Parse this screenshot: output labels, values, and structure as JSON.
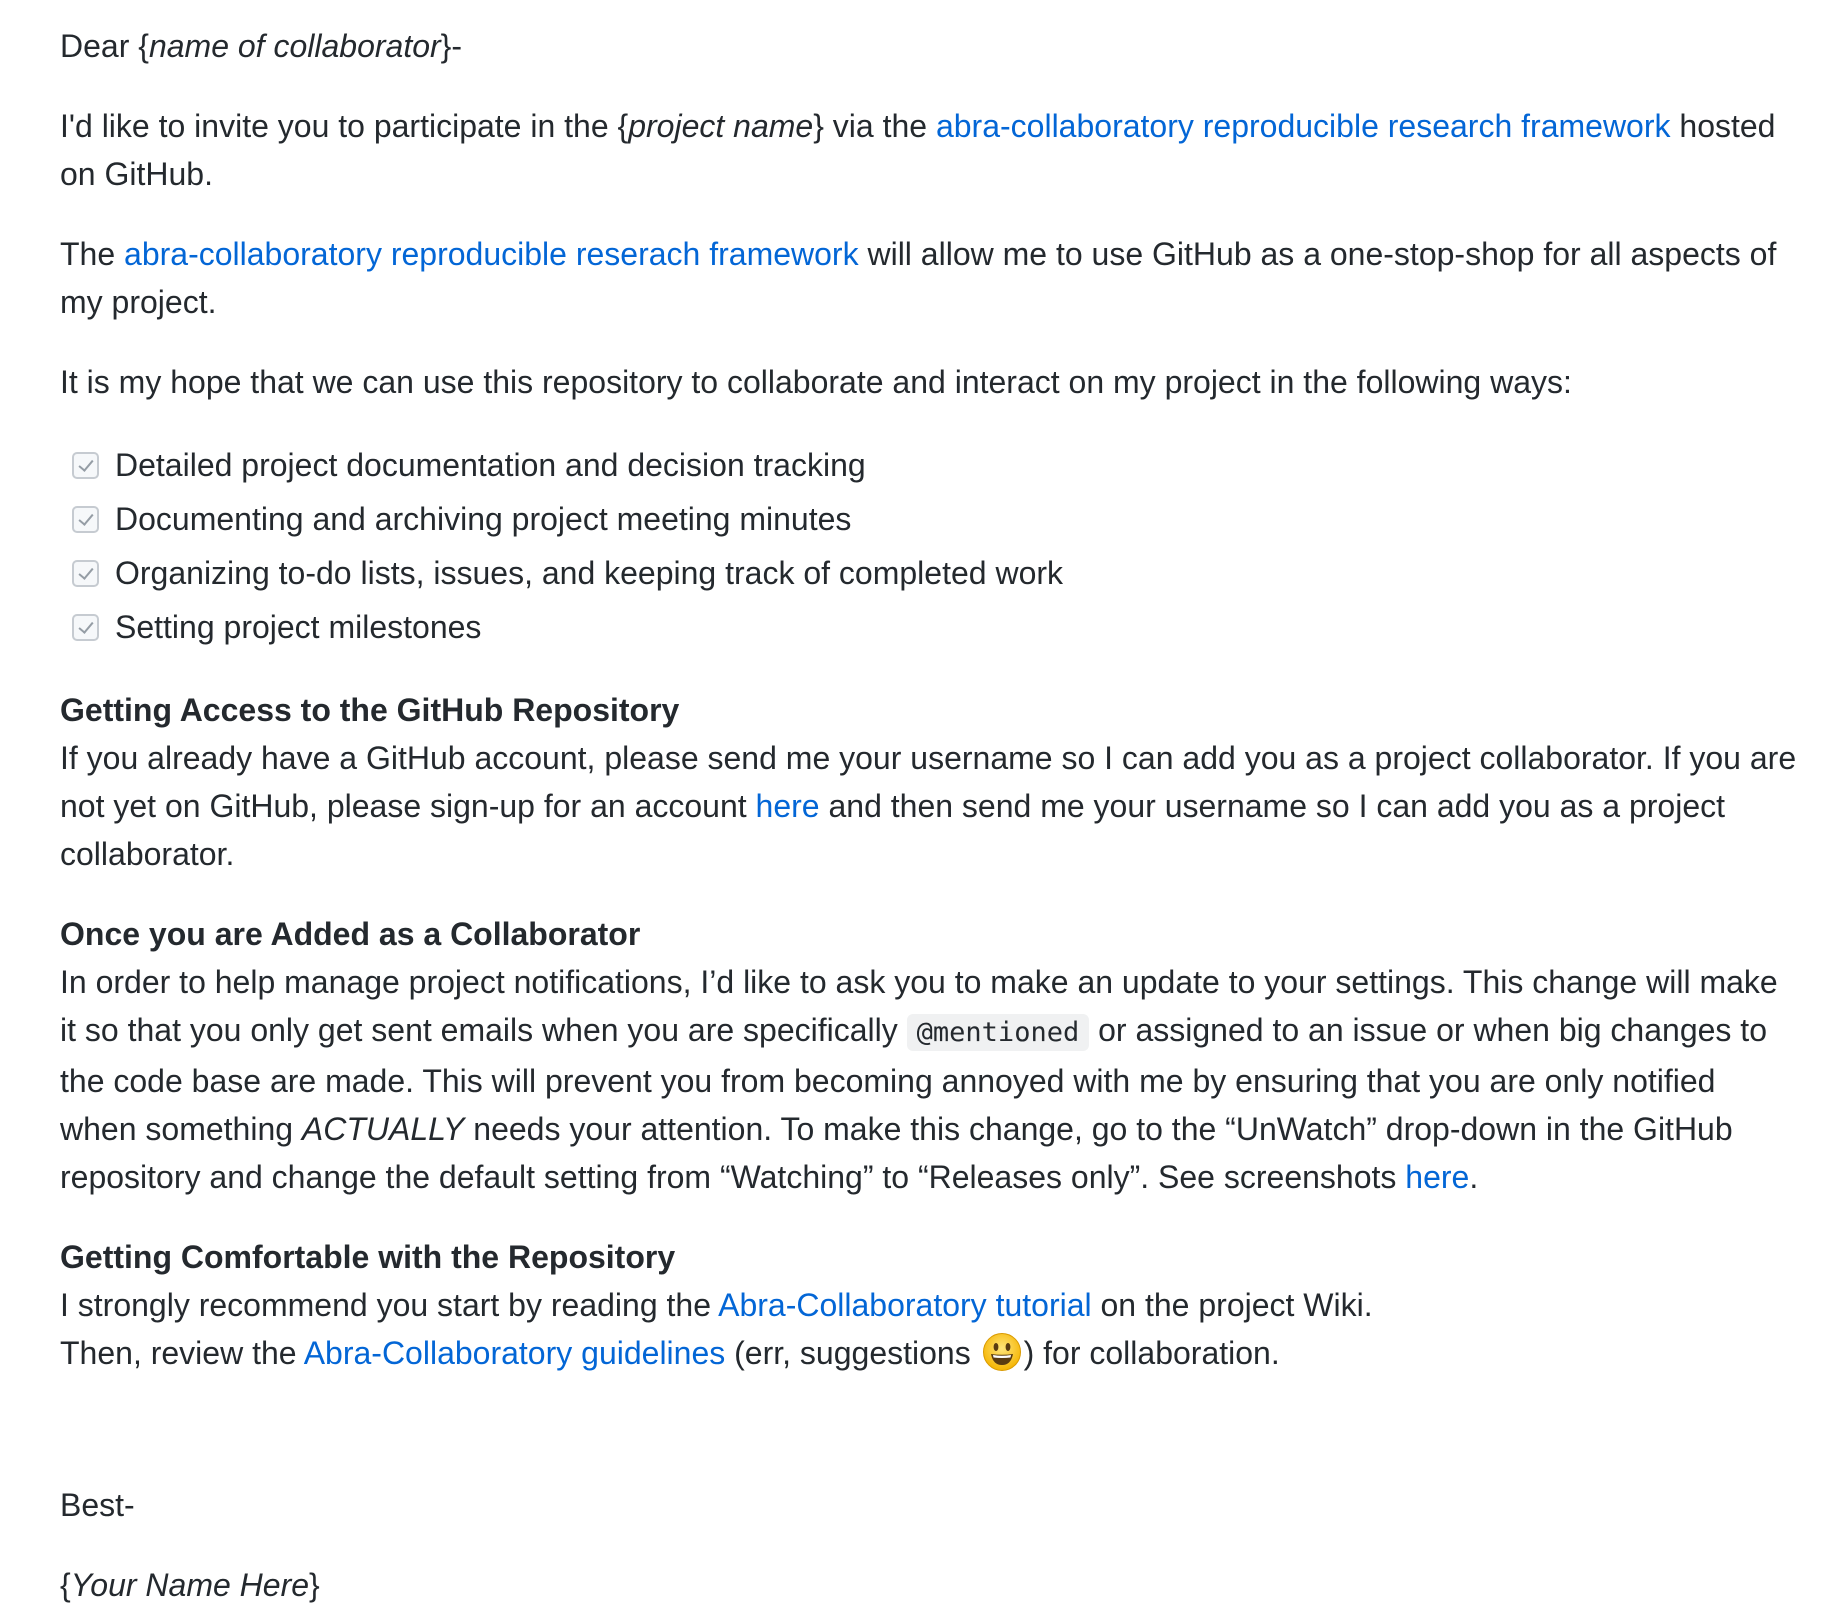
{
  "greeting": {
    "prefix": "Dear {",
    "name_placeholder": "name of collaborator",
    "suffix": "}-"
  },
  "intro": {
    "text1": "I'd like to invite you to participate in the {",
    "project_placeholder": "project name",
    "text2": "} via the ",
    "link": "abra-collaboratory reproducible research framework",
    "text3": " hosted on GitHub."
  },
  "framework": {
    "text1": "The ",
    "link": "abra-collaboratory reproducible reserach framework",
    "text2": " will allow me to use GitHub as a one-stop-shop for all aspects of my project."
  },
  "hope": "It is my hope that we can use this repository to collaborate and interact on my project in the following ways:",
  "tasks": [
    {
      "label": "Detailed project documentation and decision tracking",
      "checked": true
    },
    {
      "label": "Documenting and archiving project meeting minutes",
      "checked": true
    },
    {
      "label": "Organizing to-do lists, issues, and keeping track of completed work",
      "checked": true
    },
    {
      "label": "Setting project milestones",
      "checked": true
    }
  ],
  "access": {
    "heading": "Getting Access to the GitHub Repository",
    "text1": "If you already have a GitHub account, please send me your username so I can add you as a project collaborator. If you are not yet on GitHub, please sign-up for an account ",
    "link": "here",
    "text2": " and then send me your username so I can add you as a project collaborator."
  },
  "added": {
    "heading": "Once you are Added as a Collaborator",
    "text1": "In order to help manage project notifications, I’d like to ask you to make an update to your settings. This change will make it so that you only get sent emails when you are specifically ",
    "code": "@mentioned",
    "text2": " or assigned to an issue or when big changes to the code base are made. This will prevent you from becoming annoyed with me by ensuring that you are only notified when something ",
    "emphasis": "ACTUALLY",
    "text3": " needs your attention. To make this change, go to the “UnWatch” drop-down in the GitHub repository and change the default setting from “Watching” to “Releases only”. See screenshots ",
    "link": "here",
    "text4": "."
  },
  "comfortable": {
    "heading": "Getting Comfortable with the Repository",
    "line1_text1": "I strongly recommend you start by reading the ",
    "line1_link": "Abra-Collaboratory tutorial",
    "line1_text2": " on the project Wiki.",
    "line2_text1": "Then, review the ",
    "line2_link": "Abra-Collaboratory guidelines",
    "line2_text2": " (err, suggestions ",
    "line2_text3": ") for collaboration.",
    "emoji": "smiley-emoji"
  },
  "closing": "Best-",
  "signature": {
    "prefix": "{",
    "name_placeholder": "Your Name Here",
    "suffix": "}"
  }
}
